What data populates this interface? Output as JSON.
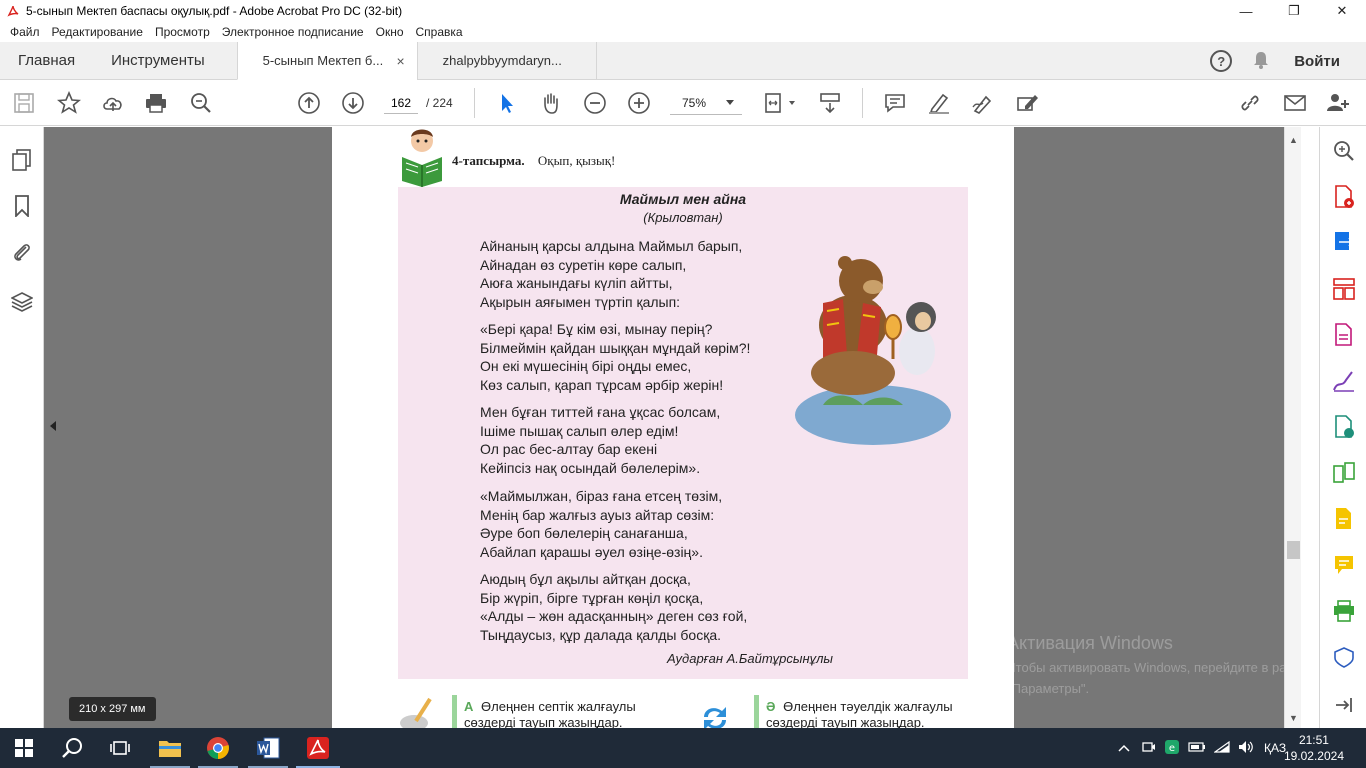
{
  "window": {
    "title": "5-сынып Мектеп баспасы оқулық.pdf - Adobe Acrobat Pro DC (32-bit)",
    "minimize": "—",
    "maximize": "❐",
    "close": "✕"
  },
  "menu": [
    "Файл",
    "Редактирование",
    "Просмотр",
    "Электронное подписание",
    "Окно",
    "Справка"
  ],
  "tabs": {
    "home": "Главная",
    "tools": "Инструменты",
    "documents": [
      {
        "label": "5-сынып Мектеп б...",
        "close": "×"
      },
      {
        "label": "zhalpybbyymdaryn..."
      }
    ],
    "help": "?",
    "signin": "Войти"
  },
  "toolbar": {
    "page_current": "162",
    "page_total": "/ 224",
    "zoom": "75%"
  },
  "document": {
    "task_label": "4-тапсырма.",
    "task_text": "Оқып, қызық!",
    "poem_title": "Маймыл мен айна",
    "poem_subtitle": "(Крыловтан)",
    "stanzas": [
      [
        "Айнаның қарсы алдына Маймыл барып,",
        "Айнадан өз суретін көре салып,",
        "Аюға жанындағы күліп айтты,",
        "Ақырын аяғымен түртіп қалып:"
      ],
      [
        "«Бері қара! Бұ кім өзі, мынау перің?",
        "Білмеймін қайдан шыққан мұндай көрім?!",
        "Он екі мүшесінің бірі оңды емес,",
        "Көз салып, қарап тұрсам әрбір жерін!"
      ],
      [
        "Мен бұған титтей ғана ұқсас болсам,",
        "Ішіме пышақ салып өлер едім!",
        "Ол рас бес-алтау бар екені",
        "Кейіпсіз нақ осындай бөлелерім»."
      ],
      [
        "«Маймылжан, біраз ғана етсең төзім,",
        "Менің бар жалғыз ауыз айтар сөзім:",
        "Әуре боп бөлелерің санағанша,",
        "Абайлап қарашы әуел өзіңе-өзің»."
      ],
      [
        "Аюдың бұл ақылы айтқан досқа,",
        "Бір жүріп, бірге тұрған көңіл қосқа,",
        "«Алды – жөн адасқанның» деген сөз ғой,",
        "Тыңдаусыз, құр далада қалды босқа."
      ]
    ],
    "translator": "Аударған А.Байтұрсынұлы",
    "exercise_a_letter": "А",
    "exercise_a_text": "Өлеңнен септік жалғаулы сөздерді тауып жазыңдар.",
    "exercise_b_letter": "Ә",
    "exercise_b_text": "Өлеңнен тәуелдік жалғаулы сөздерді тауып жазыңдар."
  },
  "page_size_tip": "210 x 297 мм",
  "activation": {
    "title": "Активация Windows",
    "text": "Чтобы активировать Windows, перейдите в раздел \"Параметры\"."
  },
  "taskbar": {
    "language": "ҚАЗ",
    "time": "21:51",
    "date": "19.02.2024"
  },
  "colors": {
    "page_pink": "#f6e4ef",
    "doc_gray": "#777777",
    "acrobat_red": "#d9231f",
    "taskbar_bg": "#1f2a38"
  }
}
